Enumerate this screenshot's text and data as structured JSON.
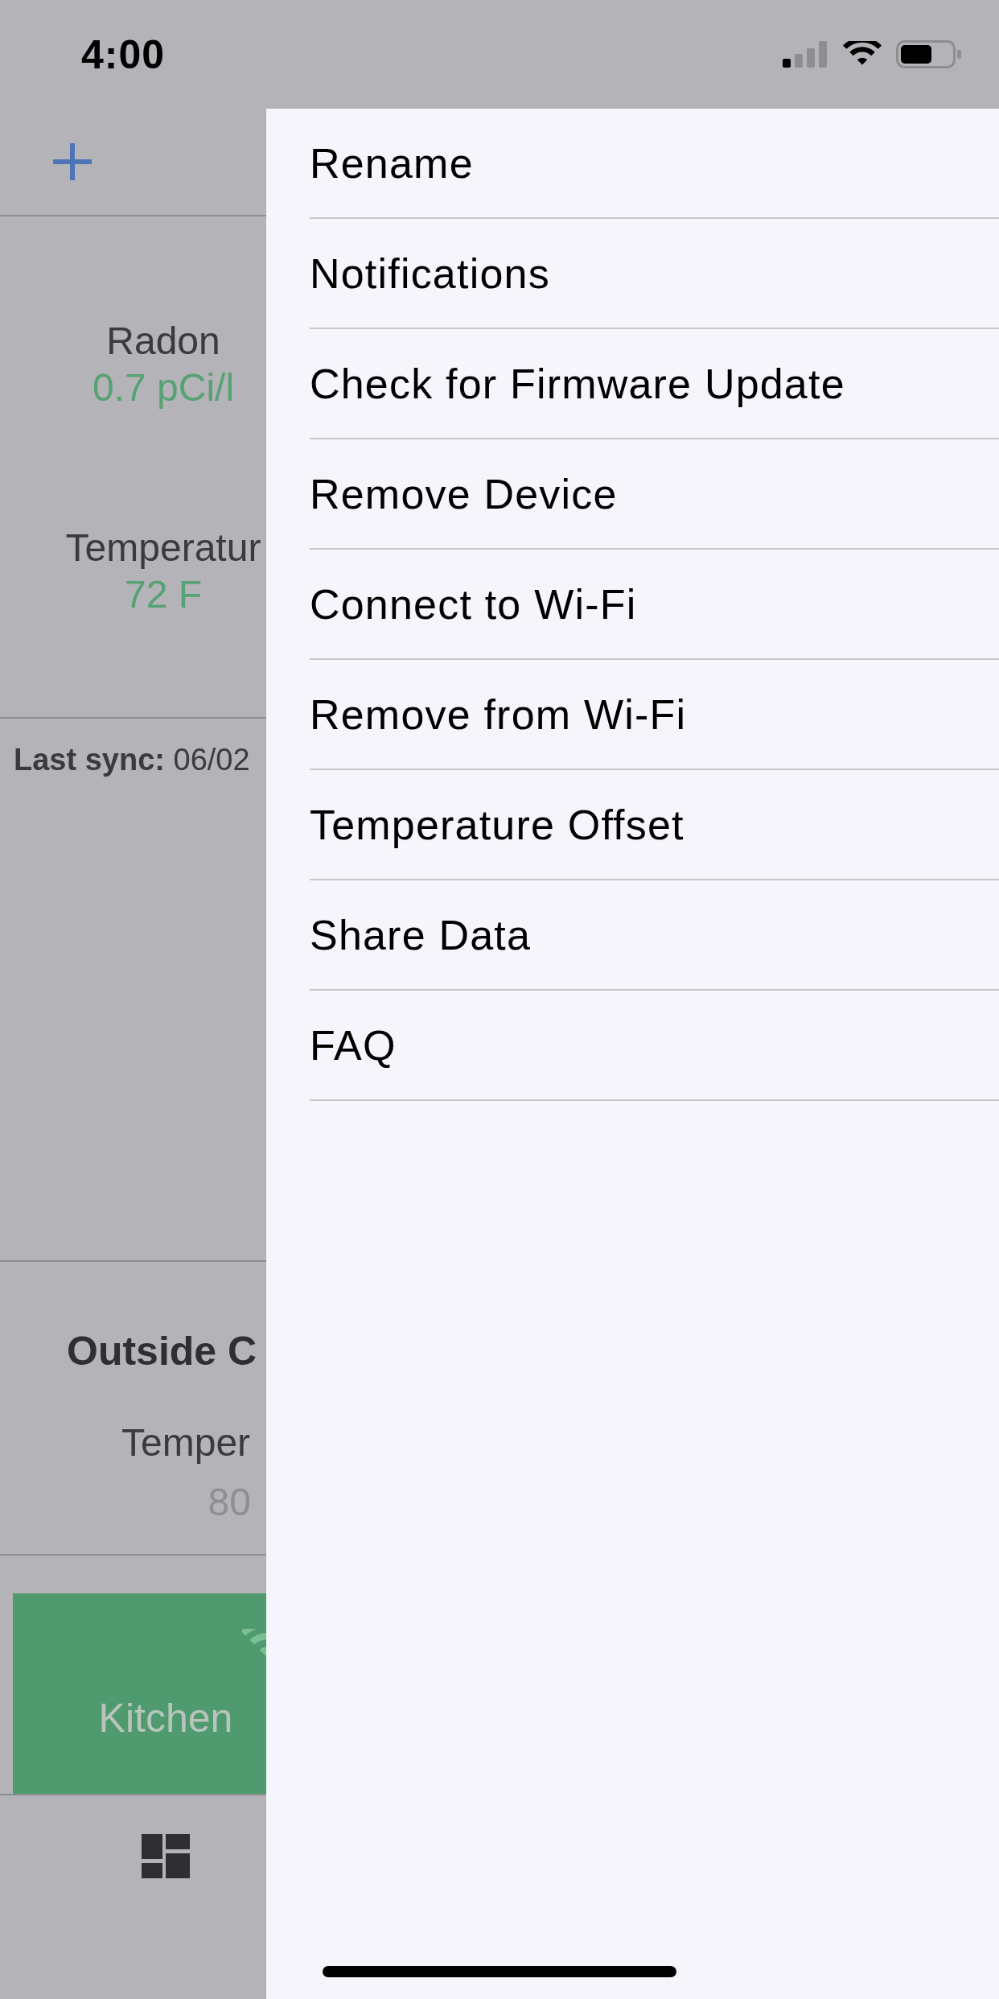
{
  "status_bar": {
    "time": "4:00"
  },
  "dashboard": {
    "readings": [
      {
        "label": "Radon",
        "value": "0.7 pCi/l"
      },
      {
        "label": "Temperatur",
        "value": "72 F"
      }
    ],
    "last_sync": "**Last sync:** 06/02"
  },
  "outside": {
    "title": "Outside C",
    "readings": [
      {
        "label": "Temper",
        "value": "80"
      }
    ]
  },
  "devices": [
    {
      "name": "Kitchen"
    }
  ],
  "menu": {
    "items": [
      "Rename",
      "Notifications",
      "Check for Firmware Update",
      "Remove Device",
      "Connect to Wi-Fi",
      "Remove from Wi-Fi",
      "Temperature Offset",
      "Share Data",
      "FAQ"
    ]
  }
}
